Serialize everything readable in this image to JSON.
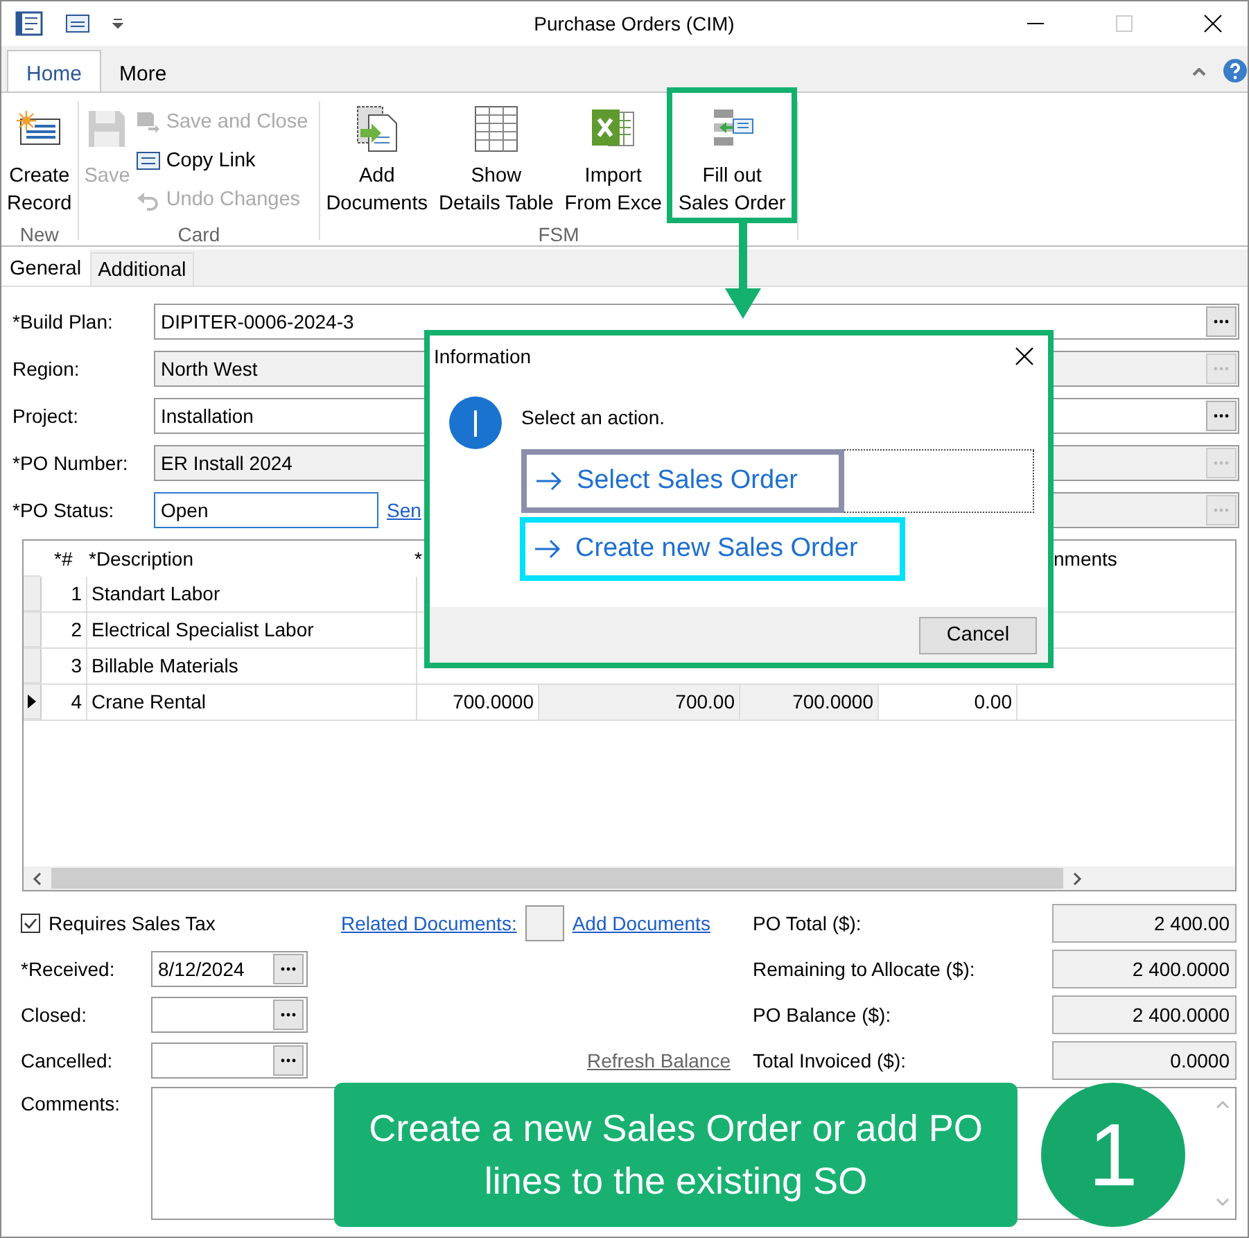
{
  "window": {
    "title": "Purchase Orders (CIM)"
  },
  "ribbon_tabs": [
    {
      "label": "Home",
      "selected": true
    },
    {
      "label": "More",
      "selected": false
    }
  ],
  "ribbon_groups": [
    {
      "name": "New",
      "buttons": [
        {
          "kind": "large",
          "label": "Create\nRecord",
          "disabled": false,
          "highlighted": false
        }
      ]
    },
    {
      "name": "Card",
      "buttons": [
        {
          "kind": "large",
          "label": "Save",
          "disabled": true,
          "highlighted": false
        },
        {
          "kind": "small",
          "label": "Save and Close",
          "disabled": true,
          "highlighted": false
        },
        {
          "kind": "small",
          "label": "Copy Link",
          "disabled": false,
          "highlighted": false
        },
        {
          "kind": "small",
          "label": "Undo Changes",
          "disabled": true,
          "highlighted": false
        }
      ]
    },
    {
      "name": "FSM",
      "buttons": [
        {
          "kind": "large",
          "label": "Add\nDocuments",
          "disabled": false,
          "highlighted": false
        },
        {
          "kind": "large",
          "label": "Show\nDetails Table",
          "disabled": false,
          "highlighted": false
        },
        {
          "kind": "large",
          "label": "Import\nFrom Exce",
          "disabled": false,
          "highlighted": false
        },
        {
          "kind": "large",
          "label": "Fill out\nSales Order",
          "disabled": false,
          "highlighted": true
        }
      ]
    }
  ],
  "page_tabs": [
    {
      "label": "General",
      "selected": true
    },
    {
      "label": "Additional",
      "selected": false
    }
  ],
  "fields": [
    {
      "label": "*Build Plan:",
      "value": "DIPITER-0006-2024-3",
      "readonly": false,
      "focused": false
    },
    {
      "label": "Region:",
      "value": "North West",
      "readonly": true,
      "focused": false
    },
    {
      "label": "Project:",
      "value": "Installation",
      "readonly": false,
      "focused": false
    },
    {
      "label": "*PO Number:",
      "value": "ER Install 2024",
      "readonly": true,
      "focused": false
    },
    {
      "label": "*PO Status:",
      "value": "Open",
      "readonly": false,
      "focused": true,
      "link": "Sen",
      "side_field_readonly": true
    }
  ],
  "table": {
    "columns": [
      "*#",
      "*Description",
      "*",
      "nments"
    ],
    "rows": [
      {
        "num": "1",
        "description": "Standart Labor",
        "current": false
      },
      {
        "num": "2",
        "description": "Electrical Specialist Labor",
        "current": false
      },
      {
        "num": "3",
        "description": "Billable Materials",
        "current": false
      },
      {
        "num": "4",
        "description": "Crane Rental",
        "current": true,
        "values": [
          {
            "text": "700.0000",
            "shaded": false
          },
          {
            "text": "700.00",
            "shaded": true
          },
          {
            "text": "700.0000",
            "shaded": true
          },
          {
            "text": "0.00",
            "shaded": false
          }
        ]
      }
    ]
  },
  "requires_sales_tax": {
    "label": "Requires Sales Tax",
    "checked": true
  },
  "links": [
    "Related Documents:",
    "Add Documents"
  ],
  "dates": [
    {
      "label": "*Received:",
      "value": "8/12/2024"
    },
    {
      "label": "Closed:"
    },
    {
      "label": "Cancelled:"
    }
  ],
  "refresh_link": "Refresh Balance",
  "totals": [
    {
      "label": "PO Total ($):",
      "value": "2 400.00"
    },
    {
      "label": "Remaining to Allocate ($):",
      "value": "2 400.0000"
    },
    {
      "label": "PO Balance ($):",
      "value": "2 400.0000"
    },
    {
      "label": "Total Invoiced ($):",
      "value": "0.0000"
    }
  ],
  "comments_label": "Comments:",
  "dialog": {
    "title": "Information",
    "message": "Select an action.",
    "options": [
      {
        "label": "Select Sales Order",
        "color": "#8b8fab",
        "focused": true
      },
      {
        "label": "Create new Sales Order",
        "color": "#00e0ff",
        "focused": false
      }
    ],
    "cancel": "Cancel"
  },
  "callout": {
    "text": "Create a new Sales Order or add PO lines to the existing SO",
    "step": "1"
  }
}
